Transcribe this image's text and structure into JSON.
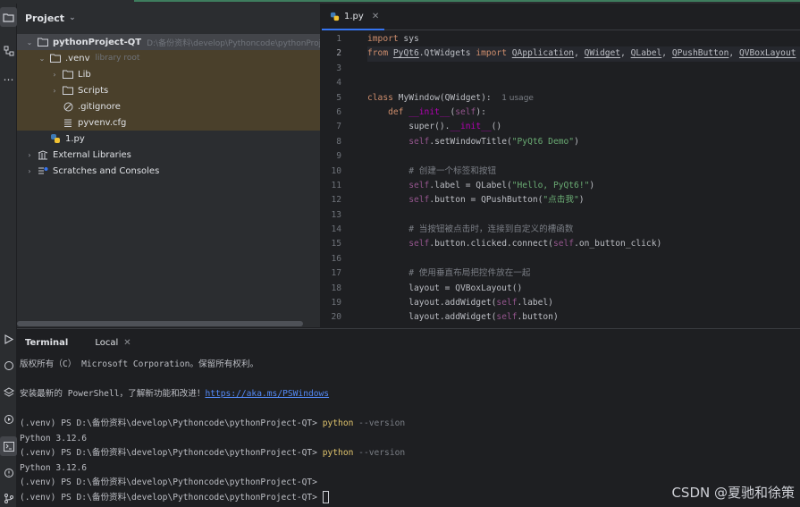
{
  "project_panel": {
    "title": "Project",
    "tree": [
      {
        "label": "pythonProject-QT",
        "hint": "D:\\备份资料\\develop\\Pythoncode\\pythonProject-QT",
        "icon": "folder-icon",
        "expanded": true
      },
      {
        "label": ".venv",
        "hint": "library root",
        "icon": "folder-icon",
        "expanded": true
      },
      {
        "label": "Lib",
        "icon": "folder-icon"
      },
      {
        "label": "Scripts",
        "icon": "folder-icon"
      },
      {
        "label": ".gitignore",
        "icon": "ignore-file-icon"
      },
      {
        "label": "pyvenv.cfg",
        "icon": "config-file-icon"
      },
      {
        "label": "1.py",
        "icon": "python-file-icon"
      },
      {
        "label": "External Libraries",
        "icon": "library-icon"
      },
      {
        "label": "Scratches and Consoles",
        "icon": "scratches-icon"
      }
    ]
  },
  "editor": {
    "tab_label": "1.py",
    "current_line": 2,
    "inlay_usage": "1 usage",
    "line_numbers": [
      "1",
      "2",
      "3",
      "4",
      "5",
      "6",
      "7",
      "8",
      "9",
      "10",
      "11",
      "12",
      "13",
      "14",
      "15",
      "16",
      "17",
      "18",
      "19",
      "20"
    ]
  },
  "code": {
    "l1_kw": "import",
    "l1_rest": " sys",
    "l2_from": "from",
    "l2_mod": "PyQt6",
    "l2_mod2": ".QtWidgets ",
    "l2_import": "import",
    "l2_a": "QApplication",
    "l2_b": "QWidget",
    "l2_c": "QLabel",
    "l2_d": "QPushButton",
    "l2_e": "QVBoxLayout",
    "l5_kw": "class",
    "l5_name": " MyWindow(QWidget):",
    "l6_kw": "def",
    "l6_fn": "__init__",
    "l6_self": "self",
    "l7_a": "super().",
    "l7_fn": "__init__",
    "l7_b": "()",
    "l8_self": "self",
    "l8_a": ".setWindowTitle(",
    "l8_str": "\"PyQt6 Demo\"",
    "l8_b": ")",
    "l10_cmt": "# 创建一个标签和按钮",
    "l11_self": "self",
    "l11_a": ".label = QLabel(",
    "l11_str": "\"Hello, PyQt6!\"",
    "l11_b": ")",
    "l12_self": "self",
    "l12_a": ".button = QPushButton(",
    "l12_str": "\"点击我\"",
    "l12_b": ")",
    "l14_cmt": "# 当按钮被点击时，连接到自定义的槽函数",
    "l15_self": "self",
    "l15_a": ".button.clicked.connect(",
    "l15_self2": "self",
    "l15_b": ".on_button_click)",
    "l17_cmt": "# 使用垂直布局把控件放在一起",
    "l18": "layout = QVBoxLayout()",
    "l19_a": "layout.addWidget(",
    "l19_self": "self",
    "l19_b": ".label)",
    "l20_a": "layout.addWidget(",
    "l20_self": "self",
    "l20_b": ".button)"
  },
  "terminal": {
    "title": "Terminal",
    "tab": "Local",
    "line1": "版权所有（C） Microsoft Corporation。保留所有权利。",
    "line2_text": "安装最新的 PowerShell，了解新功能和改进！",
    "line2_link": "https://aka.ms/PSWindows",
    "prompt": "(.venv) PS D:\\备份资料\\develop\\Pythoncode\\pythonProject-QT> ",
    "cmd": "python",
    "arg": " --version",
    "output": "Python 3.12.6"
  },
  "watermark": "CSDN @夏驰和徐策",
  "colors": {
    "accent": "#3574f0",
    "keyword": "#cf8e6d",
    "string": "#6aab73",
    "self": "#94558d",
    "function": "#56a8f5"
  }
}
